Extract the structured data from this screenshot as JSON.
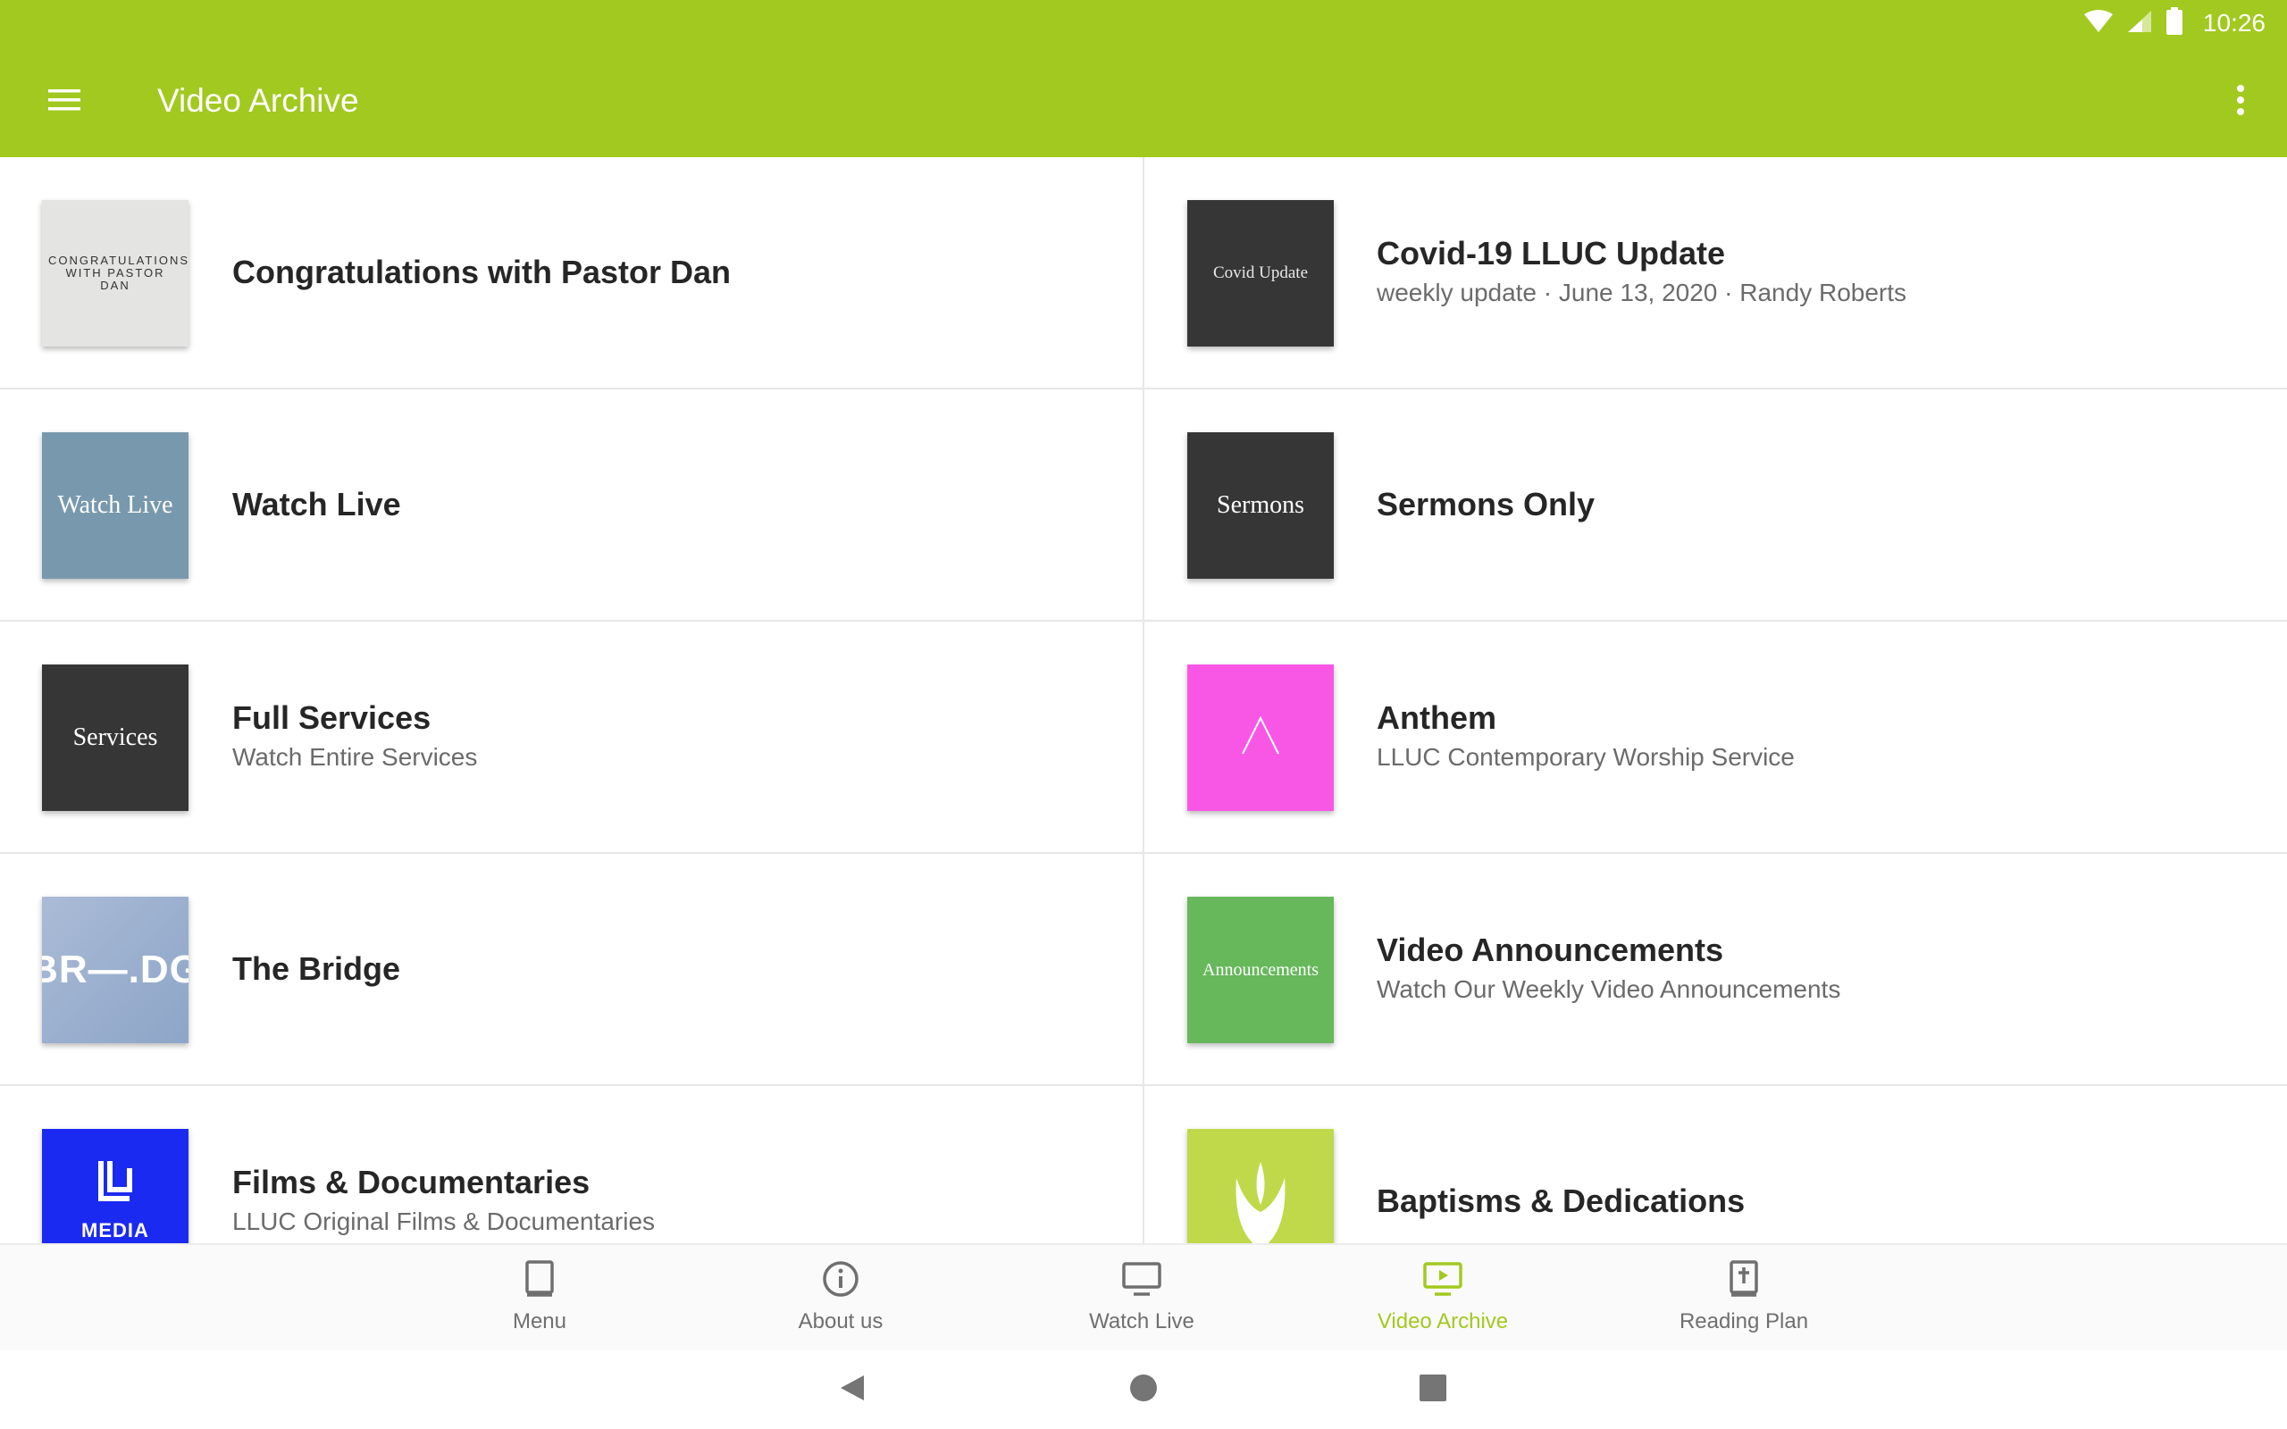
{
  "status_bar": {
    "time": "10:26"
  },
  "app_bar": {
    "title": "Video Archive"
  },
  "items": [
    {
      "title": "Congratulations with Pastor Dan",
      "subtitle": "",
      "thumb_text": "CONGRATULATIONS WITH PASTOR DAN",
      "thumb_bg": "#e4e4e2",
      "thumb_fg": "#333333"
    },
    {
      "title": "Covid-19 LLUC Update",
      "subtitle": "weekly update · June 13, 2020 · Randy Roberts",
      "thumb_text": "Covid Update",
      "thumb_bg": "#363636",
      "thumb_fg": "#e8e8e8"
    },
    {
      "title": "Watch Live",
      "subtitle": "",
      "thumb_text": "Watch Live",
      "thumb_bg": "#7899ad",
      "thumb_fg": "#ffffff"
    },
    {
      "title": "Sermons Only",
      "subtitle": "",
      "thumb_text": "Sermons",
      "thumb_bg": "#363636",
      "thumb_fg": "#ffffff"
    },
    {
      "title": "Full Services",
      "subtitle": "Watch Entire Services",
      "thumb_text": "Services",
      "thumb_bg": "#363636",
      "thumb_fg": "#ffffff"
    },
    {
      "title": "Anthem",
      "subtitle": "LLUC Contemporary Worship Service",
      "thumb_text": "",
      "thumb_bg": "#f857e6",
      "thumb_fg": "#ffffff"
    },
    {
      "title": "The Bridge",
      "subtitle": "",
      "thumb_text": "BR—.DG",
      "thumb_bg": "#9fb3d2",
      "thumb_fg": "#ffffff"
    },
    {
      "title": "Video Announcements",
      "subtitle": "Watch Our Weekly Video Announcements",
      "thumb_text": "Announcements",
      "thumb_bg": "#66b85a",
      "thumb_fg": "#ffffff"
    },
    {
      "title": "Films & Documentaries",
      "subtitle": "LLUC Original Films & Documentaries",
      "thumb_text": "MEDIA",
      "thumb_bg": "#1a2af0",
      "thumb_fg": "#ffffff"
    },
    {
      "title": "Baptisms & Dedications",
      "subtitle": "",
      "thumb_text": "",
      "thumb_bg": "#bfd94a",
      "thumb_fg": "#ffffff"
    }
  ],
  "bottom_nav": [
    {
      "label": "Menu",
      "icon": "book-icon",
      "active": false
    },
    {
      "label": "About us",
      "icon": "info-icon",
      "active": false
    },
    {
      "label": "Watch Live",
      "icon": "monitor-icon",
      "active": false
    },
    {
      "label": "Video Archive",
      "icon": "video-play-icon",
      "active": true
    },
    {
      "label": "Reading Plan",
      "icon": "bible-icon",
      "active": false
    }
  ],
  "colors": {
    "accent": "#a2c920",
    "title_text": "#262626",
    "subtitle_text": "#6b6b6b"
  }
}
